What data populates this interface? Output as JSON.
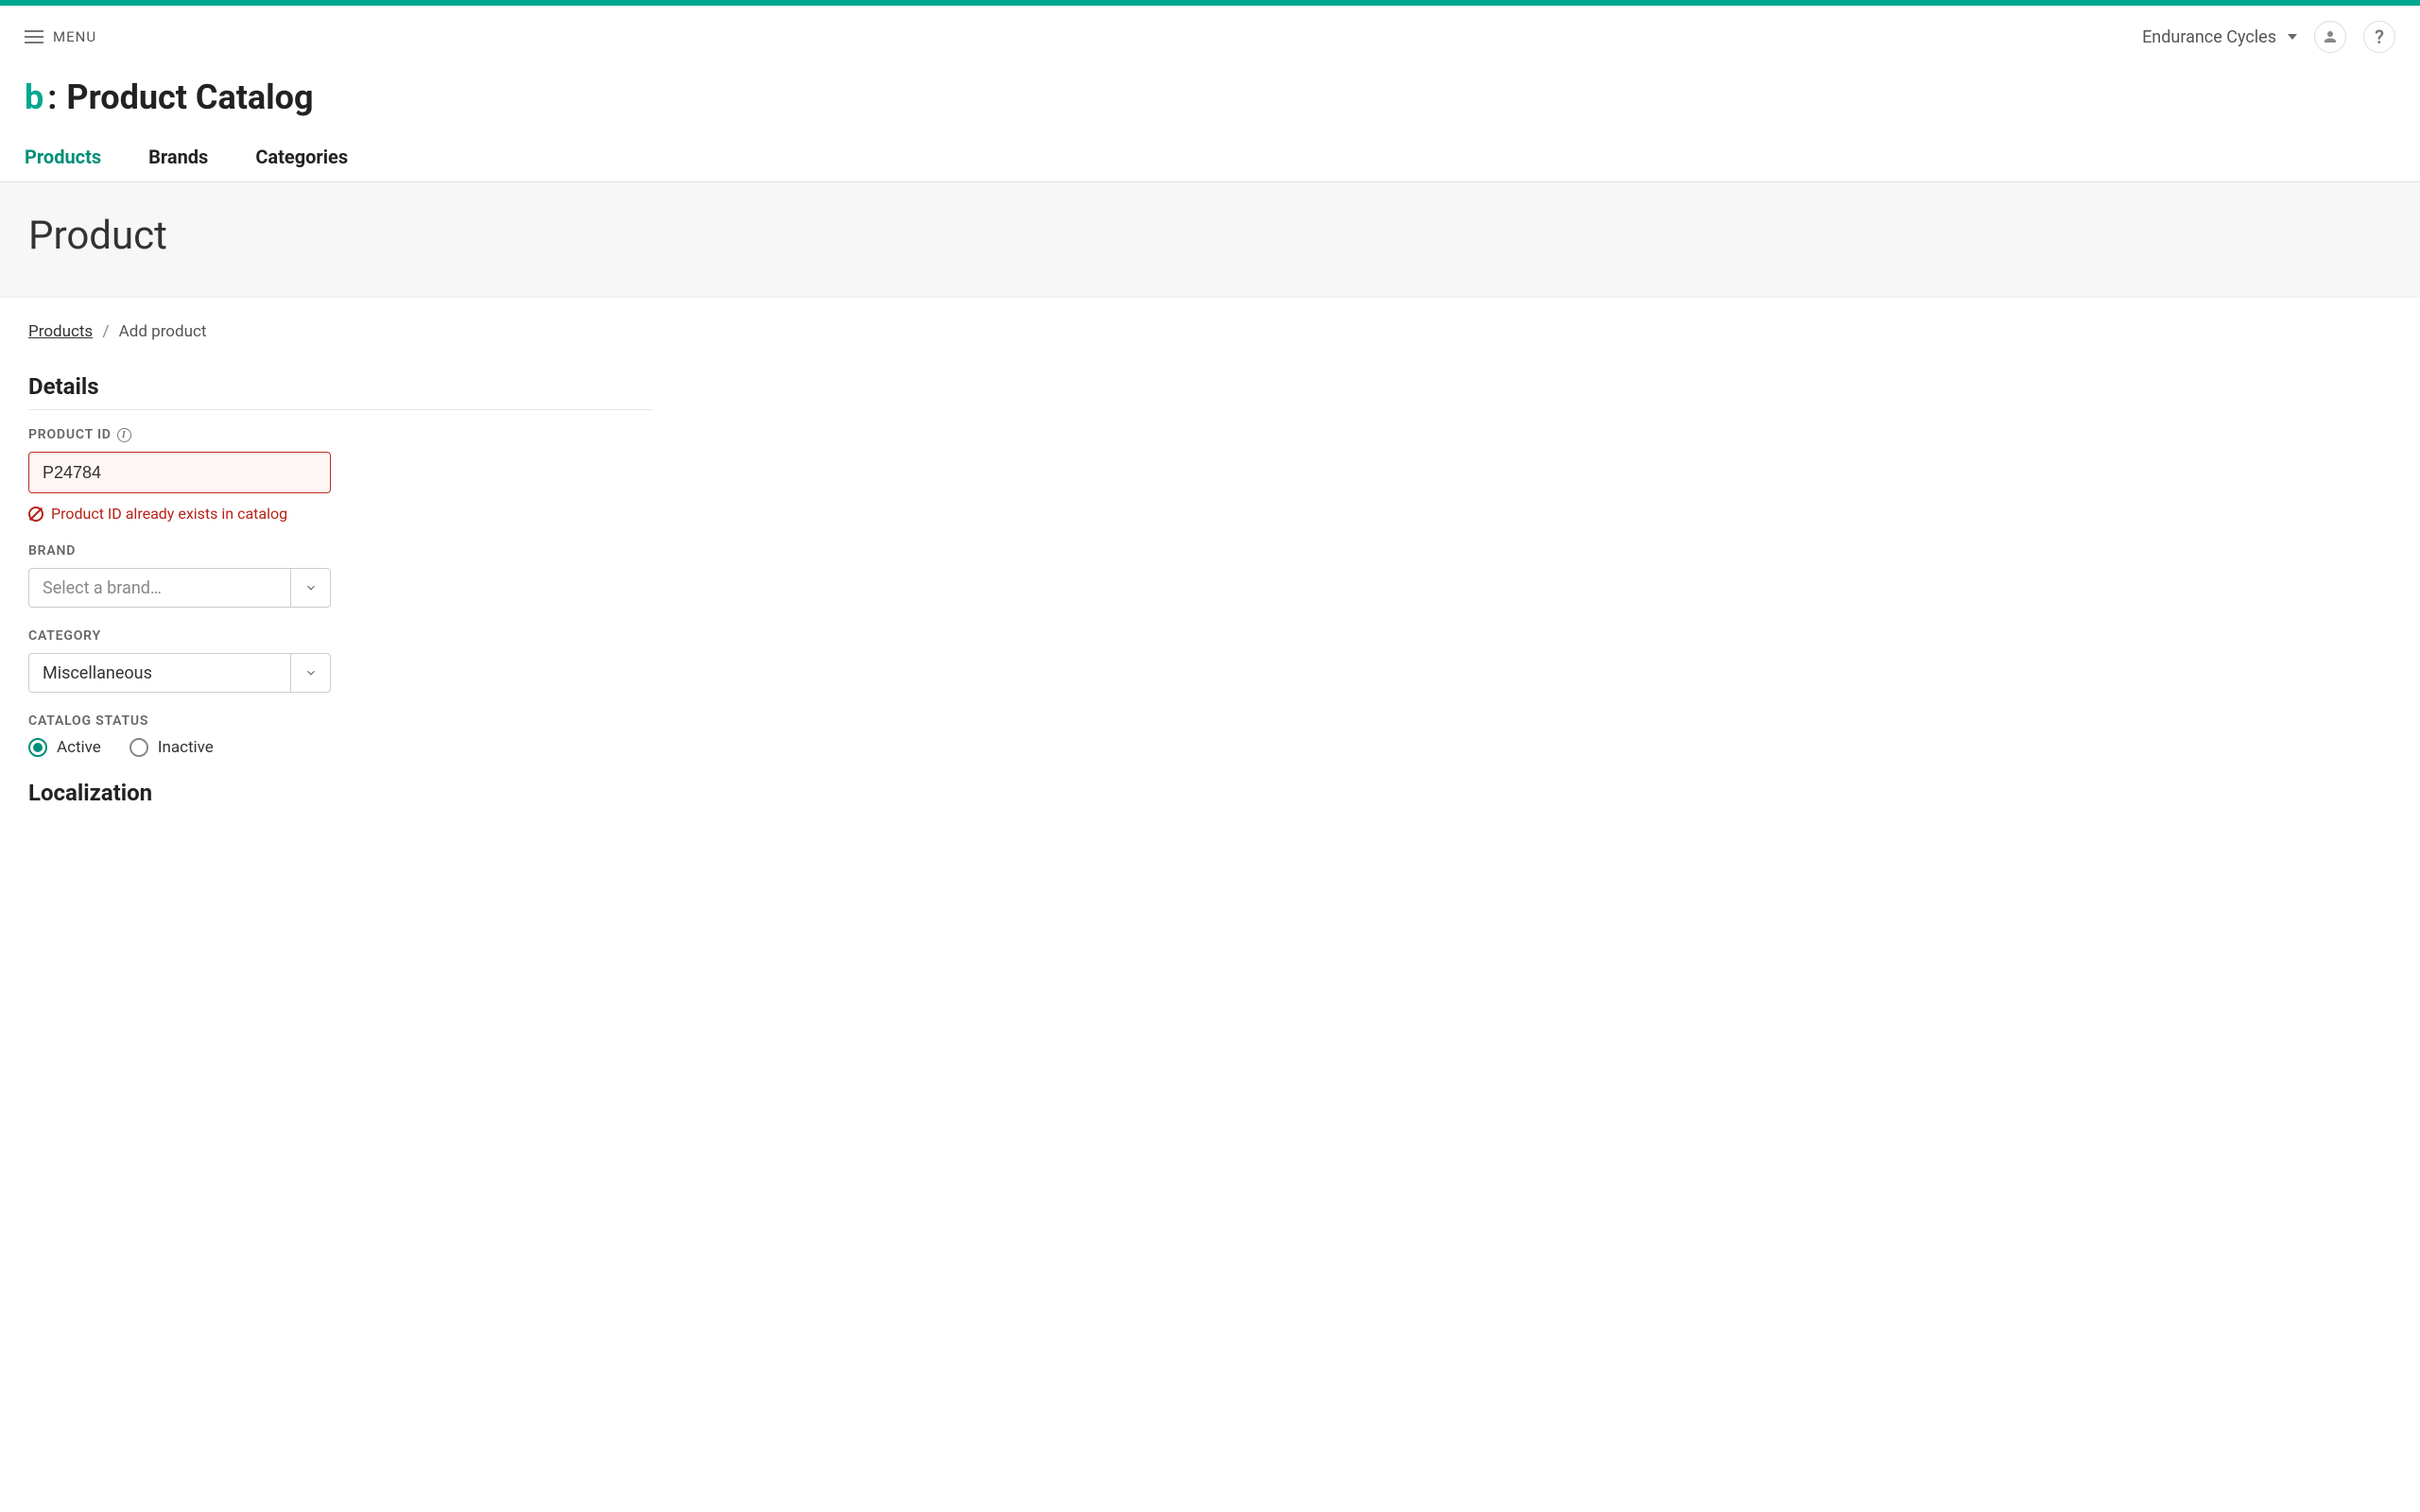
{
  "header": {
    "menu_label": "MENU",
    "org_name": "Endurance Cycles"
  },
  "title": {
    "logo_letter": "b",
    "logo_colon": ":",
    "main": "Product Catalog"
  },
  "tabs": {
    "products": "Products",
    "brands": "Brands",
    "categories": "Categories"
  },
  "subheader": {
    "title": "Product"
  },
  "breadcrumb": {
    "parent": "Products",
    "separator": "/",
    "current": "Add product"
  },
  "sections": {
    "details": "Details",
    "localization": "Localization"
  },
  "form": {
    "product_id": {
      "label": "PRODUCT ID",
      "value": "P24784",
      "error": "Product ID already exists in catalog"
    },
    "brand": {
      "label": "BRAND",
      "placeholder": "Select a brand…"
    },
    "category": {
      "label": "CATEGORY",
      "value": "Miscellaneous"
    },
    "catalog_status": {
      "label": "CATALOG STATUS",
      "active": "Active",
      "inactive": "Inactive"
    }
  }
}
